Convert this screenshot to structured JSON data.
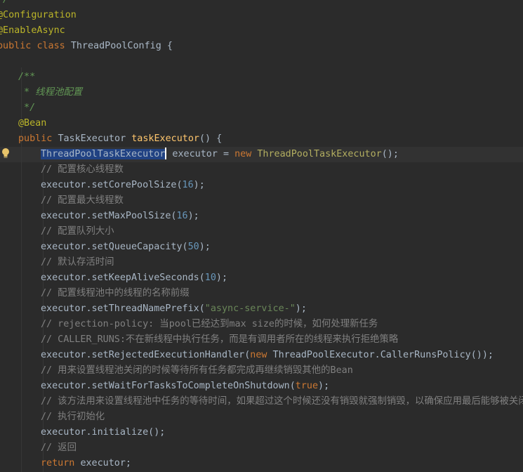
{
  "editor": {
    "lines": [
      {
        "tokens": [
          {
            "t": "*/",
            "c": "doc"
          }
        ]
      },
      {
        "tokens": [
          {
            "t": "@Configuration",
            "c": "ann"
          }
        ]
      },
      {
        "tokens": [
          {
            "t": "@EnableAsync",
            "c": "ann"
          }
        ]
      },
      {
        "tokens": [
          {
            "t": "public ",
            "c": "kw"
          },
          {
            "t": "class ",
            "c": "kw"
          },
          {
            "t": "ThreadPoolConfig {",
            "c": "plain"
          }
        ]
      },
      {
        "tokens": []
      },
      {
        "tokens": [
          {
            "t": "/**",
            "c": "doc"
          }
        ]
      },
      {
        "tokens": [
          {
            "t": " * 线程池配置",
            "c": "doc"
          }
        ]
      },
      {
        "tokens": [
          {
            "t": " */",
            "c": "doc"
          }
        ]
      },
      {
        "tokens": [
          {
            "t": "@Bean",
            "c": "ann"
          }
        ]
      },
      {
        "tokens": [
          {
            "t": "public ",
            "c": "kw"
          },
          {
            "t": "TaskExecutor ",
            "c": "plain"
          },
          {
            "t": "taskExecutor",
            "c": "method"
          },
          {
            "t": "() {",
            "c": "plain"
          }
        ]
      },
      {
        "tokens": [
          {
            "t": "ThreadPoolTaskExecutor",
            "c": "sel"
          },
          {
            "t": "",
            "c": "caret"
          },
          {
            "t": " executor = ",
            "c": "plain"
          },
          {
            "t": "new ",
            "c": "kw"
          },
          {
            "t": "ThreadPoolTaskExecutor",
            "c": "generic"
          },
          {
            "t": "();",
            "c": "plain"
          }
        ]
      },
      {
        "tokens": [
          {
            "t": "// 配置核心线程数",
            "c": "comment"
          }
        ]
      },
      {
        "tokens": [
          {
            "t": "executor.setCorePoolSize(",
            "c": "plain"
          },
          {
            "t": "16",
            "c": "num"
          },
          {
            "t": ");",
            "c": "plain"
          }
        ]
      },
      {
        "tokens": [
          {
            "t": "// 配置最大线程数",
            "c": "comment"
          }
        ]
      },
      {
        "tokens": [
          {
            "t": "executor.setMaxPoolSize(",
            "c": "plain"
          },
          {
            "t": "16",
            "c": "num"
          },
          {
            "t": ");",
            "c": "plain"
          }
        ]
      },
      {
        "tokens": [
          {
            "t": "// 配置队列大小",
            "c": "comment"
          }
        ]
      },
      {
        "tokens": [
          {
            "t": "executor.setQueueCapacity(",
            "c": "plain"
          },
          {
            "t": "50",
            "c": "num"
          },
          {
            "t": ");",
            "c": "plain"
          }
        ]
      },
      {
        "tokens": [
          {
            "t": "// 默认存活时间",
            "c": "comment"
          }
        ]
      },
      {
        "tokens": [
          {
            "t": "executor.setKeepAliveSeconds(",
            "c": "plain"
          },
          {
            "t": "10",
            "c": "num"
          },
          {
            "t": ");",
            "c": "plain"
          }
        ]
      },
      {
        "tokens": [
          {
            "t": "// 配置线程池中的线程的名称前缀",
            "c": "comment"
          }
        ]
      },
      {
        "tokens": [
          {
            "t": "executor.setThreadNamePrefix(",
            "c": "plain"
          },
          {
            "t": "\"async-service-\"",
            "c": "str"
          },
          {
            "t": ");",
            "c": "plain"
          }
        ]
      },
      {
        "tokens": [
          {
            "t": "// rejection-policy: 当pool已经达到max size的时候，如何处理新任务",
            "c": "comment"
          }
        ]
      },
      {
        "tokens": [
          {
            "t": "// CALLER_RUNS:不在新线程中执行任务，而是有调用者所在的线程来执行拒绝策略",
            "c": "comment"
          }
        ]
      },
      {
        "tokens": [
          {
            "t": "executor.setRejectedExecutionHandler(",
            "c": "plain"
          },
          {
            "t": "new ",
            "c": "kw"
          },
          {
            "t": "ThreadPoolExecutor.CallerRunsPolicy());",
            "c": "plain"
          }
        ]
      },
      {
        "tokens": [
          {
            "t": "// 用来设置线程池关闭的时候等待所有任务都完成再继续销毁其他的Bean",
            "c": "comment"
          }
        ]
      },
      {
        "tokens": [
          {
            "t": "executor.setWaitForTasksToCompleteOnShutdown(",
            "c": "plain"
          },
          {
            "t": "true",
            "c": "kw"
          },
          {
            "t": ");",
            "c": "plain"
          }
        ]
      },
      {
        "tokens": [
          {
            "t": "// 该方法用来设置线程池中任务的等待时间，如果超过这个时候还没有销毁就强制销毁，以确保应用最后能够被关闭，",
            "c": "comment"
          }
        ]
      },
      {
        "tokens": [
          {
            "t": "// 执行初始化",
            "c": "comment"
          }
        ]
      },
      {
        "tokens": [
          {
            "t": "executor.initialize();",
            "c": "plain"
          }
        ]
      },
      {
        "tokens": [
          {
            "t": "// 返回",
            "c": "comment"
          }
        ]
      },
      {
        "tokens": [
          {
            "t": "return ",
            "c": "kw"
          },
          {
            "t": "executor;",
            "c": "plain"
          }
        ]
      }
    ]
  }
}
